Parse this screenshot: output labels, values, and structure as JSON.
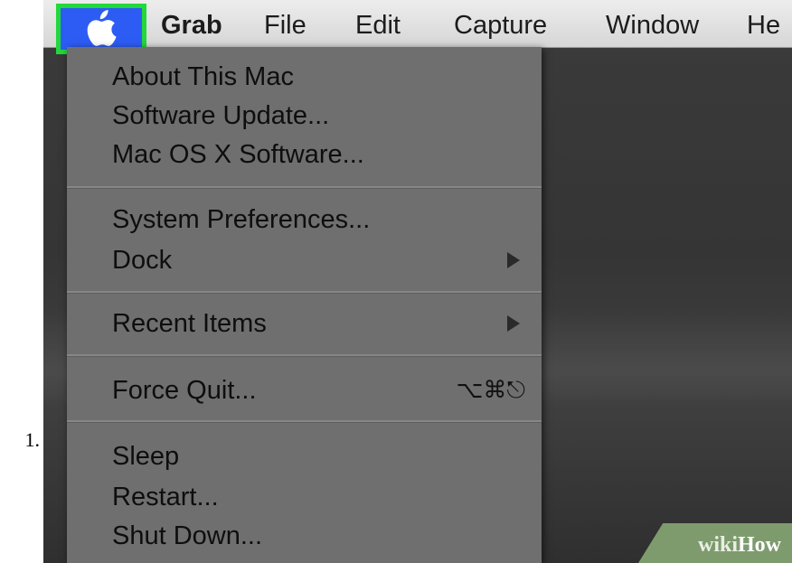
{
  "list_number": "1.",
  "menubar": {
    "apple_icon": "apple-logo-icon",
    "items": [
      {
        "label": "Grab",
        "bold": true
      },
      {
        "label": "File"
      },
      {
        "label": "Edit"
      },
      {
        "label": "Capture"
      },
      {
        "label": "Window"
      },
      {
        "label": "He"
      }
    ]
  },
  "apple_menu": {
    "items": [
      {
        "label": "About This Mac"
      },
      {
        "label": "Software Update..."
      },
      {
        "label": "Mac OS X Software..."
      },
      {
        "label": "System Preferences..."
      },
      {
        "label": "Dock",
        "submenu": true
      },
      {
        "label": "Recent Items",
        "submenu": true
      },
      {
        "label": "Force Quit...",
        "shortcut": "⌥⌘⎋"
      },
      {
        "label": "Sleep"
      },
      {
        "label": "Restart..."
      },
      {
        "label": "Shut Down..."
      }
    ]
  },
  "watermark": {
    "wiki": "wiki",
    "how": "How"
  },
  "colors": {
    "highlight_border": "#22d83a",
    "apple_button": "#2d5cf5",
    "menu_bg": "#6f6f6f"
  }
}
